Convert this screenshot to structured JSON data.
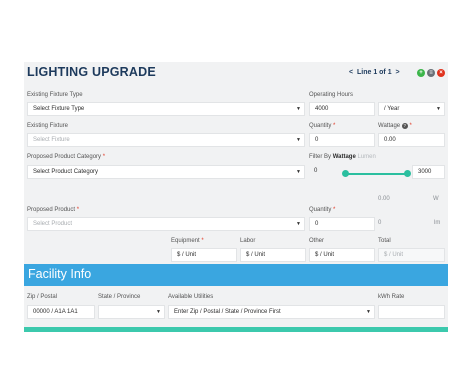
{
  "header": {
    "title": "LIGHTING UPGRADE",
    "line_prev": "<",
    "line_text": "Line 1 of 1",
    "line_next": ">",
    "add_icon": "plus-icon",
    "copy_icon": "copy-icon",
    "delete_icon": "delete-icon"
  },
  "existing_fixture_type": {
    "label": "Existing Fixture Type",
    "value": "Select Fixture Type"
  },
  "operating_hours": {
    "label": "Operating Hours",
    "value": "4000",
    "period": "/ Year"
  },
  "existing_fixture": {
    "label": "Existing Fixture",
    "placeholder": "Select Fixture"
  },
  "quantity_existing": {
    "label": "Quantity",
    "required": "*",
    "value": "0"
  },
  "wattage": {
    "label": "Wattage",
    "help": "?",
    "required": "*",
    "value": "0.00"
  },
  "proposed_category": {
    "label": "Proposed Product Category",
    "required": "*",
    "value": "Select Product Category"
  },
  "filter": {
    "label": "Filter By",
    "opt_wattage": "Wattage",
    "opt_lumen": "Lumen",
    "min": "0",
    "max": "3000",
    "min_fraction": 0,
    "max_fraction": 1
  },
  "proposed_product": {
    "label": "Proposed Product",
    "required": "*",
    "placeholder": "Select Product"
  },
  "quantity_proposed": {
    "label": "Quantity",
    "required": "*",
    "value": "0"
  },
  "watts_value": "0.00",
  "watts_unit": "W",
  "lumens_value": "0",
  "lumens_unit": "lm",
  "costs": {
    "equipment": {
      "label": "Equipment",
      "required": "*",
      "value": "$ / Unit"
    },
    "labor": {
      "label": "Labor",
      "value": "$ / Unit"
    },
    "other": {
      "label": "Other",
      "value": "$ / Unit"
    },
    "total": {
      "label": "Total",
      "value": "$ / Unit"
    }
  },
  "facility": {
    "title": "Facility Info",
    "zip": {
      "label": "Zip / Postal",
      "value": "00000 / A1A 1A1"
    },
    "state": {
      "label": "State / Province",
      "value": ""
    },
    "utilities": {
      "label": "Available Utilities",
      "value": "Enter Zip / Postal / State / Province First"
    },
    "kwh": {
      "label": "kWh Rate",
      "value": ""
    }
  },
  "colors": {
    "accent_blue": "#3aa6e0",
    "teal": "#3cc9ad",
    "title_navy": "#1d3a5c",
    "required_red": "#e0331e"
  }
}
